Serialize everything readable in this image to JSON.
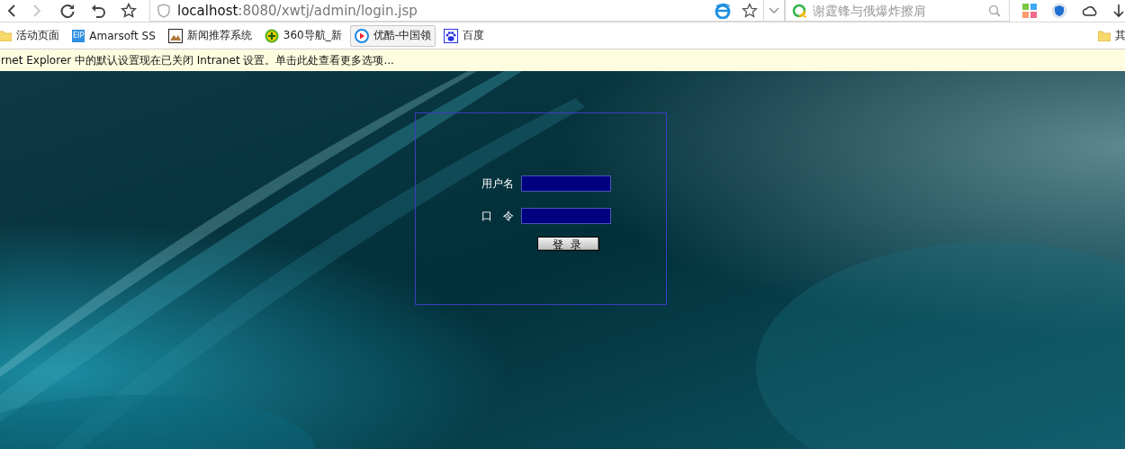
{
  "toolbar": {
    "back_disabled": false,
    "forward_disabled": true,
    "url_host": "localhost",
    "url_path": ":8080/xwtj/admin/login.jsp",
    "search": {
      "placeholder": "谢霆锋与俄爆炸擦肩"
    }
  },
  "bookmarks": [
    {
      "label": "活动页面",
      "kind": "folder",
      "selected": false
    },
    {
      "label": "Amarsoft SS",
      "kind": "badge",
      "badge": "EIP",
      "selected": false
    },
    {
      "label": "新闻推荐系统",
      "selected": false
    },
    {
      "label": "360导航_新",
      "kind": "plus",
      "selected": false
    },
    {
      "label": "优酷-中国领",
      "kind": "play",
      "selected": true
    },
    {
      "label": "百度",
      "kind": "paw",
      "selected": false
    }
  ],
  "other_bookmarks": {
    "label": "其"
  },
  "info_bar": {
    "text": "rnet Explorer 中的默认设置现在已关闭 Intranet 设置。单击此处查看更多选项..."
  },
  "login": {
    "fields": [
      {
        "label": "用户名"
      },
      {
        "label": "口　令"
      }
    ],
    "button": "登 录"
  }
}
